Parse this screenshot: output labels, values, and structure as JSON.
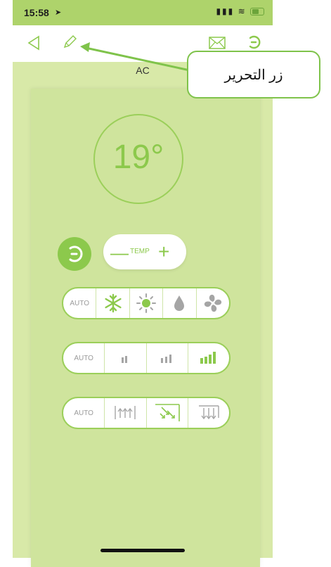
{
  "status_bar": {
    "time": "15:58",
    "signal_icon": "signal-bars-icon",
    "wifi_icon": "wifi-icon",
    "battery_icon": "battery-charging-icon"
  },
  "toolbar": {
    "back_icon": "back-triangle-icon",
    "edit_icon": "pencil-icon",
    "mail_icon": "envelope-icon",
    "power_icon": "power-icon"
  },
  "device": {
    "name": "AC"
  },
  "temperature": {
    "value": "19°"
  },
  "temp_control": {
    "label": "TEMP",
    "minus": "—",
    "plus": "+"
  },
  "mode_row": {
    "items": [
      "AUTO",
      "snowflake-icon",
      "sun-icon",
      "droplet-icon",
      "fan-icon"
    ],
    "selected": "none"
  },
  "fan_speed_row": {
    "items": [
      "AUTO",
      "fan-low-icon",
      "fan-medium-icon",
      "fan-high-icon"
    ],
    "selected": "fan-high-icon"
  },
  "swing_row": {
    "items": [
      "AUTO",
      "swing-up-icon",
      "swing-diagonal-icon",
      "swing-down-icon"
    ],
    "selected": "swing-diagonal-icon"
  },
  "callout": {
    "text": "زر التحرير"
  },
  "colors": {
    "accent": "#8cc94c",
    "background": "#d8e9a8",
    "panel": "#cfe49d",
    "status_bar": "#aed36b"
  }
}
